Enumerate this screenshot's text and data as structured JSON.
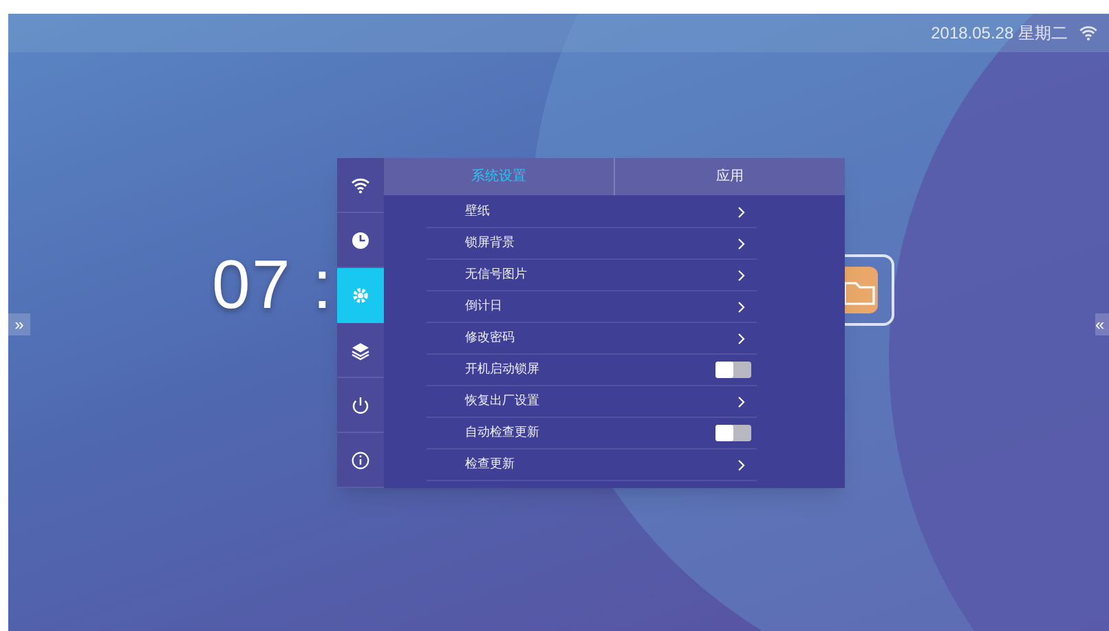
{
  "status_bar": {
    "datetime": "2018.05.28 星期二"
  },
  "clock": {
    "text": "07 :"
  },
  "edge_buttons": {
    "left": "»",
    "right": "«"
  },
  "sidebar": {
    "items": [
      {
        "kind": "wifi",
        "selected": false
      },
      {
        "kind": "clock",
        "selected": false
      },
      {
        "kind": "settings",
        "selected": true
      },
      {
        "kind": "layers",
        "selected": false
      },
      {
        "kind": "power",
        "selected": false
      },
      {
        "kind": "info",
        "selected": false
      }
    ]
  },
  "tabs": [
    {
      "label": "系统设置",
      "selected": true
    },
    {
      "label": "应用",
      "selected": false
    }
  ],
  "rows": [
    {
      "label": "壁纸",
      "kind": "link"
    },
    {
      "label": "锁屏背景",
      "kind": "link"
    },
    {
      "label": "无信号图片",
      "kind": "link"
    },
    {
      "label": "倒计日",
      "kind": "link"
    },
    {
      "label": "修改密码",
      "kind": "link"
    },
    {
      "label": "开机启动锁屏",
      "kind": "toggle",
      "on": false
    },
    {
      "label": "恢复出厂设置",
      "kind": "link"
    },
    {
      "label": "自动检查更新",
      "kind": "toggle",
      "on": false
    },
    {
      "label": "检查更新",
      "kind": "link"
    }
  ]
}
